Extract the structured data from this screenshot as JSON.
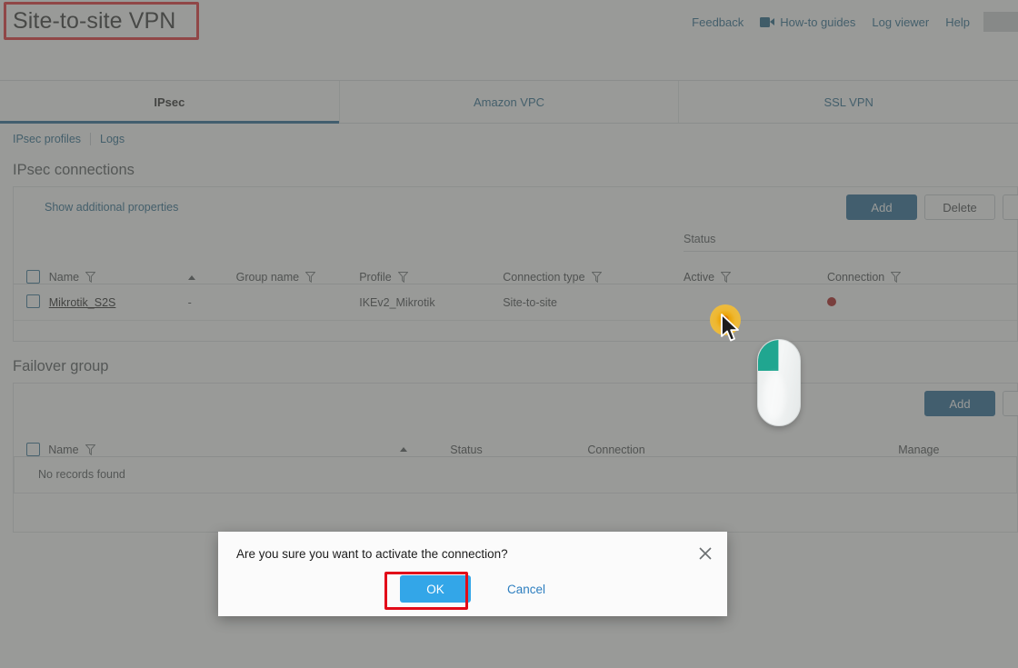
{
  "header": {
    "title": "Site-to-site VPN",
    "links": [
      {
        "label": "Feedback",
        "icon": null
      },
      {
        "label": "How-to guides",
        "icon": "video-camera-icon"
      },
      {
        "label": "Log viewer",
        "icon": null
      },
      {
        "label": "Help",
        "icon": null
      }
    ]
  },
  "tabs": [
    {
      "label": "IPsec",
      "active": true
    },
    {
      "label": "Amazon VPC",
      "active": false
    },
    {
      "label": "SSL VPN",
      "active": false
    }
  ],
  "sublinks": [
    {
      "label": "IPsec profiles"
    },
    {
      "label": "Logs"
    }
  ],
  "ipsec": {
    "section_title": "IPsec connections",
    "show_properties_label": "Show additional properties",
    "buttons": {
      "add": "Add",
      "delete": "Delete"
    },
    "columns": {
      "name": "Name",
      "group_name": "Group name",
      "profile": "Profile",
      "connection_type": "Connection type",
      "status_group": "Status",
      "active": "Active",
      "connection": "Connection"
    },
    "rows": [
      {
        "name": "Mikrotik_S2S",
        "group_name": "-",
        "profile": "IKEv2_Mikrotik",
        "connection_type": "Site-to-site",
        "active_status": "clicked",
        "connection_status_color": "#aa1212"
      }
    ]
  },
  "failover": {
    "section_title": "Failover group",
    "buttons": {
      "add": "Add"
    },
    "columns": {
      "name": "Name",
      "status": "Status",
      "connection": "Connection",
      "manage": "Manage"
    },
    "empty_text": "No records found"
  },
  "dialog": {
    "message": "Are you sure you want to activate the connection?",
    "ok_label": "OK",
    "cancel_label": "Cancel",
    "close_icon": "close-icon"
  },
  "colors": {
    "primary_blue": "#1b6291",
    "link_blue": "#20648a",
    "dialog_blue": "#33a6e8",
    "annotation_red": "#e20b19",
    "status_red": "#aa1212",
    "click_highlight": "#f0a500",
    "mouse_button": "#20a690"
  }
}
